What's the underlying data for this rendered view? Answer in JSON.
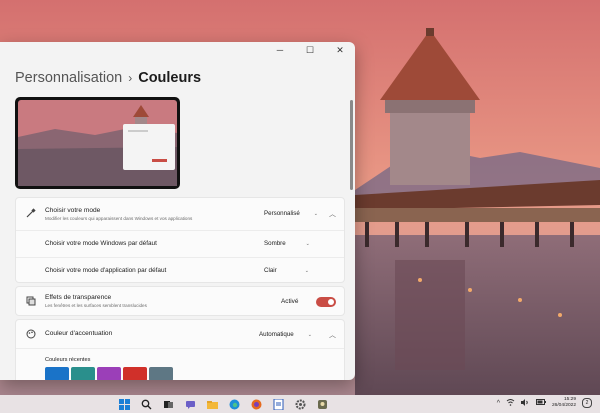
{
  "window": {
    "controls": {
      "minimize": "─",
      "maximize": "☐",
      "close": "✕"
    }
  },
  "breadcrumb": {
    "parent": "Personnalisation",
    "separator": "›",
    "current": "Couleurs"
  },
  "mode_section": {
    "title": "Choisir votre mode",
    "description": "Modifier les couleurs qui apparaissent dans Windows et vos applications",
    "value": "Personnalisé",
    "windows_mode": {
      "label": "Choisir votre mode Windows par défaut",
      "value": "Sombre"
    },
    "app_mode": {
      "label": "Choisir votre mode d'application par défaut",
      "value": "Clair"
    }
  },
  "transparency": {
    "title": "Effets de transparence",
    "description": "Les fenêtres et les surfaces semblent translucides",
    "state_label": "Activé",
    "state": true
  },
  "accent": {
    "title": "Couleur d'accentuation",
    "value": "Automatique",
    "recent_label": "Couleurs récentes",
    "recent_colors": [
      "#1a73c8",
      "#2a8f8c",
      "#9b3fb8",
      "#d0302a",
      "#5e7784"
    ]
  },
  "colors": {
    "accent": "#c94d45",
    "window_bg": "#f3f3f3",
    "card_bg": "#fbfbfb"
  },
  "taskbar": {
    "icons": [
      "start-icon",
      "search-icon",
      "task-view-icon",
      "chat-icon",
      "file-explorer-icon",
      "edge-icon",
      "firefox-icon",
      "word-document-icon",
      "settings-icon",
      "gimp-icon"
    ],
    "time": "15:29",
    "date": "26/04/2022",
    "notification_count": "2"
  }
}
